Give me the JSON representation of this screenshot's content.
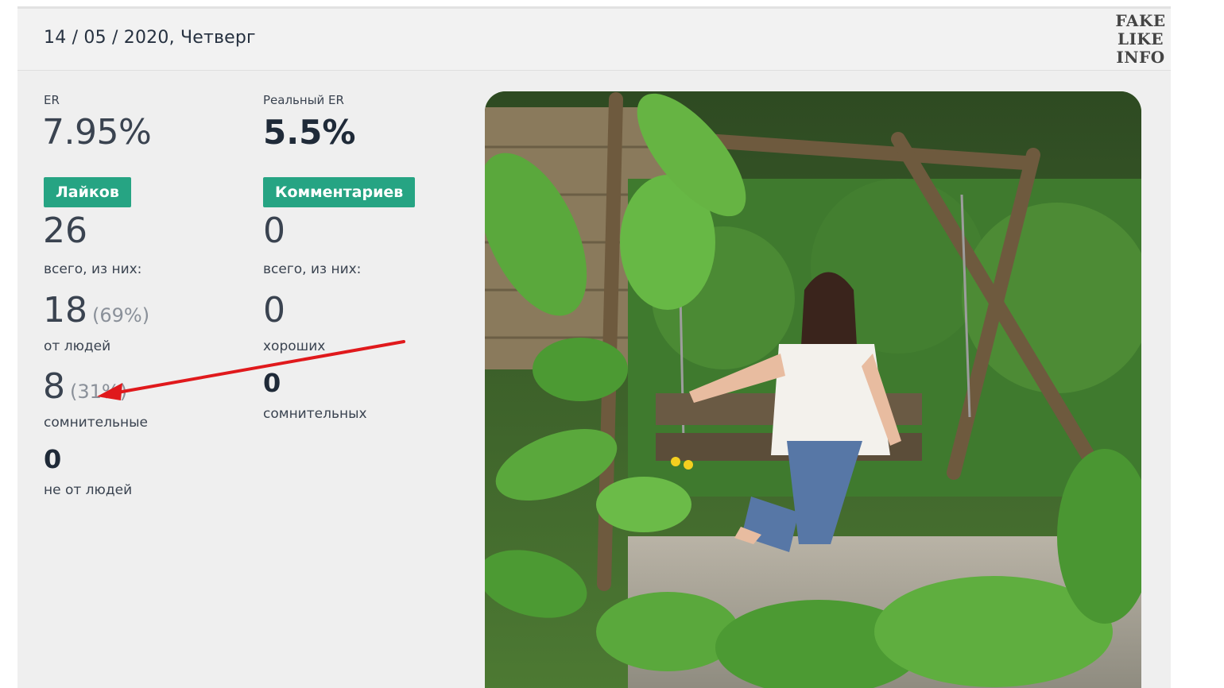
{
  "header": {
    "date": "14 / 05 / 2020, Четверг"
  },
  "watermark": {
    "lines": [
      "FAKE",
      "LIKE",
      "INFO"
    ]
  },
  "stats": {
    "er_label": "ER",
    "er_value": "7.95%",
    "real_er_label": "Реальный ER",
    "real_er_value": "5.5%"
  },
  "likes": {
    "badge": "Лайков",
    "total": "26",
    "total_caption": "всего, из них:",
    "human_count": "18",
    "human_pct": "(69%)",
    "human_caption": "от людей",
    "suspicious_count": "8",
    "suspicious_pct": "(31%)",
    "suspicious_caption": "сомнительные",
    "bots_count": "0",
    "bots_caption": "не от людей"
  },
  "comments": {
    "badge": "Комментариев",
    "total": "0",
    "total_caption": "всего, из них:",
    "good_count": "0",
    "good_caption": "хороших",
    "suspicious_count": "0",
    "suspicious_caption": "сомнительных"
  },
  "colors": {
    "badge_green": "#26a483",
    "annotation_arrow": "#e0191c",
    "card_background": "#efefef"
  },
  "photo": {
    "icon": "post-photo"
  }
}
